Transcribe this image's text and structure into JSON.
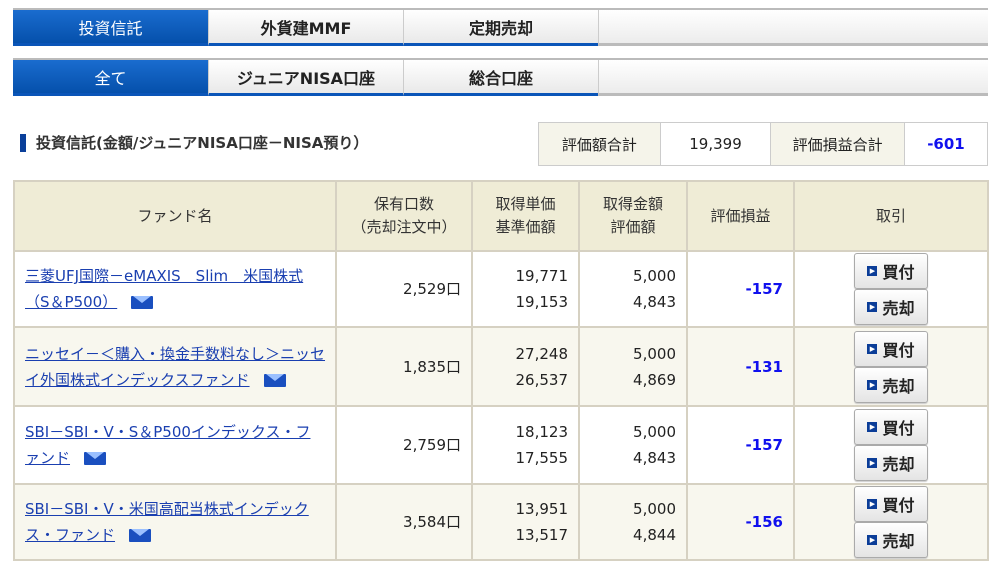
{
  "tabs1": [
    "投資信託",
    "外貨建MMF",
    "定期売却"
  ],
  "tabs2": [
    "全て",
    "ジュニアNISA口座",
    "総合口座"
  ],
  "section_title": "投資信託(金額/ジュニアNISA口座－NISA預り）",
  "summary": {
    "value_label": "評価額合計",
    "value": "19,399",
    "pl_label": "評価損益合計",
    "pl": "-601"
  },
  "headers": {
    "fund": "ファンド名",
    "units1": "保有口数",
    "units2": "（売却注文中）",
    "price1": "取得単価",
    "price2": "基準価額",
    "amt1": "取得金額",
    "amt2": "評価額",
    "pl": "評価損益",
    "trade": "取引"
  },
  "buttons": {
    "buy": "買付",
    "sell": "売却"
  },
  "rows": [
    {
      "name": "三菱UFJ国際－eMAXIS　Slim　米国株式（S＆P500）",
      "units": "2,529口",
      "cost_price": "19,771",
      "nav": "19,153",
      "cost": "5,000",
      "value": "4,843",
      "pl": "-157"
    },
    {
      "name": "ニッセイ－＜購入・換金手数料なし＞ニッセイ外国株式インデックスファンド",
      "units": "1,835口",
      "cost_price": "27,248",
      "nav": "26,537",
      "cost": "5,000",
      "value": "4,869",
      "pl": "-131"
    },
    {
      "name": "SBI－SBI・V・S＆P500インデックス・ファンド",
      "units": "2,759口",
      "cost_price": "18,123",
      "nav": "17,555",
      "cost": "5,000",
      "value": "4,843",
      "pl": "-157"
    },
    {
      "name": "SBI－SBI・V・米国高配当株式インデックス・ファンド",
      "units": "3,584口",
      "cost_price": "13,951",
      "nav": "13,517",
      "cost": "5,000",
      "value": "4,844",
      "pl": "-156"
    }
  ]
}
